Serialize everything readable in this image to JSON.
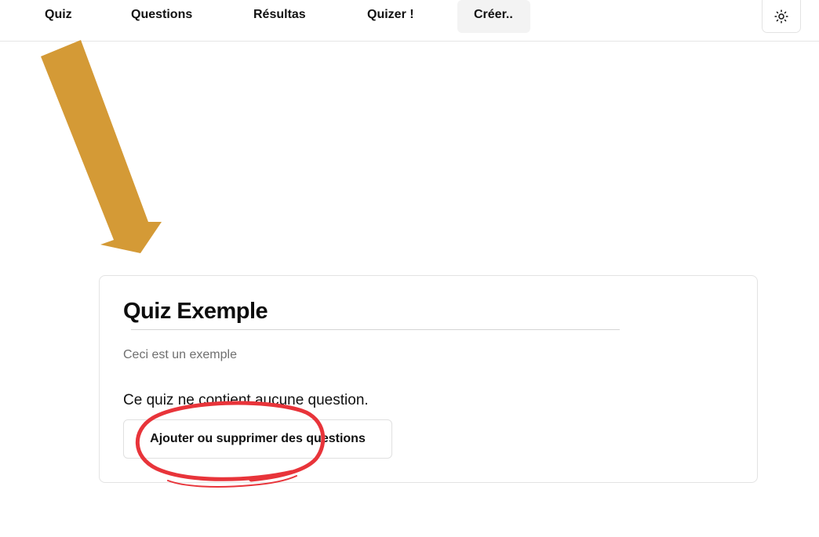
{
  "nav": {
    "items": [
      {
        "label": "Quiz"
      },
      {
        "label": "Questions"
      },
      {
        "label": "Résultas"
      },
      {
        "label": "Quizer !"
      },
      {
        "label": "Créer.."
      }
    ],
    "active_index": 4,
    "theme_toggle_icon": "sun-icon"
  },
  "quiz": {
    "title": "Quiz Exemple",
    "description": "Ceci est un exemple",
    "empty_message": "Ce quiz ne contient aucune question.",
    "edit_button_label": "Ajouter ou supprimer des questions"
  },
  "annotations": {
    "arrow_color": "#d49a36",
    "circle_color": "#e8343a"
  }
}
